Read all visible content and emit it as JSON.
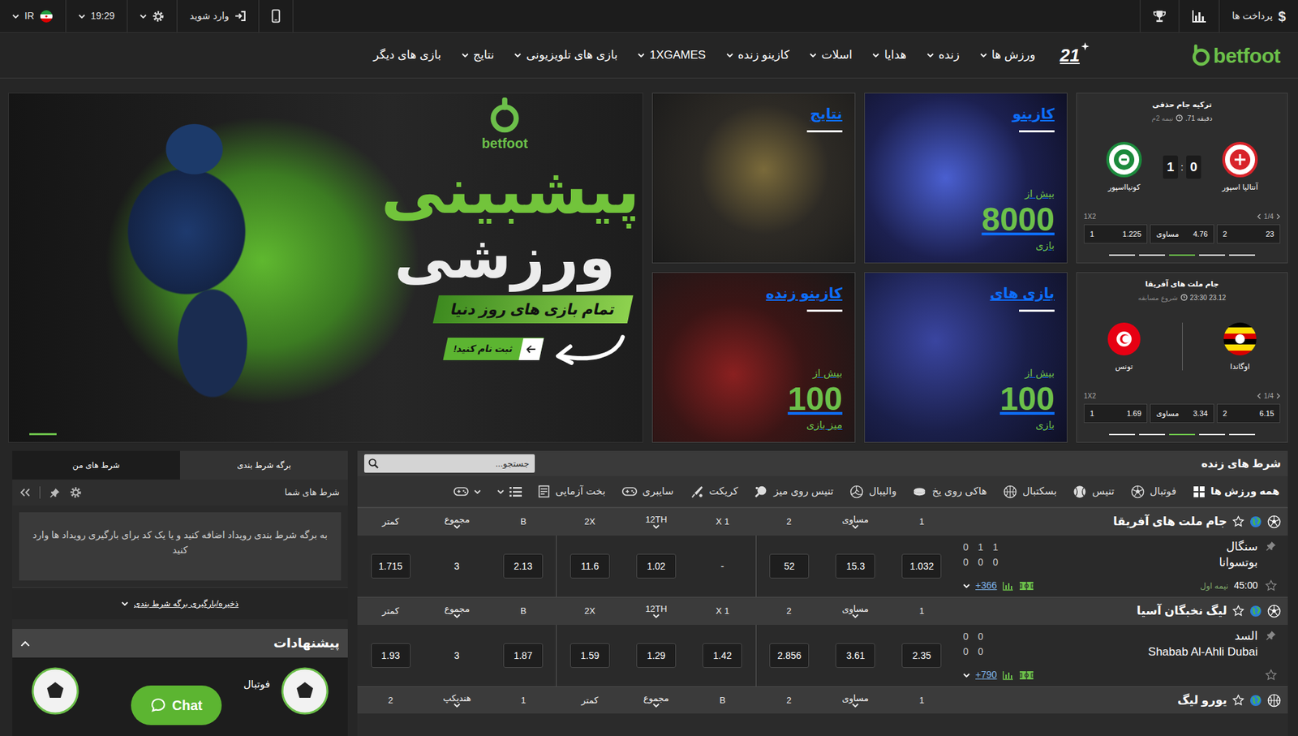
{
  "topbar": {
    "country": "IR",
    "time": "19:29",
    "login": "وارد شوید",
    "currency": "$",
    "payments": "پرداخت ها"
  },
  "nav": {
    "logo": "betfoot",
    "badge": "21",
    "items": [
      {
        "label": "ورزش ها",
        "dropdown": true
      },
      {
        "label": "زنده",
        "dropdown": true
      },
      {
        "label": "هدایا",
        "dropdown": true
      },
      {
        "label": "اسلات",
        "dropdown": true
      },
      {
        "label": "کازینو زنده",
        "dropdown": true
      },
      {
        "label": "1XGAMES",
        "dropdown": true
      },
      {
        "label": "بازی های تلویزیونی",
        "dropdown": true
      },
      {
        "label": "نتایج",
        "dropdown": true
      },
      {
        "label": "بازی های دیگر",
        "dropdown": false
      }
    ]
  },
  "banner": {
    "brand": "betfoot",
    "headline": "پیشبینی",
    "subheadline": "ورزشی",
    "tagline": "تمام بازی های روز دنیا",
    "cta": "ثبت نام کنید!",
    "slides": [
      {
        "selected": true
      }
    ]
  },
  "tile_columns": [
    [
      {
        "title": "کازینو",
        "prefix": "بیش از",
        "count": "8000",
        "unit": "بازی"
      },
      {
        "title": "بازی های",
        "prefix": "بیش از",
        "count": "100",
        "unit": "بازی"
      }
    ],
    [
      {
        "title": "نتایج"
      },
      {
        "title": "کازینو زنده",
        "prefix": "بیش از",
        "count": "100",
        "unit": "میز بازی"
      }
    ]
  ],
  "match_cards": [
    {
      "league": "ترکیه جام حذفی",
      "status": "دقیقه 71.",
      "phase": "نیمه 2م",
      "teams": [
        {
          "name": "آنتالیا اسپور",
          "score": "0"
        },
        {
          "name": "کونیااسپور",
          "score": "1"
        }
      ],
      "score_sep": ":",
      "market": "1X2",
      "page": "1/4",
      "odds": [
        {
          "label": "1",
          "value": "1.225"
        },
        {
          "label": "مساوی",
          "value": "4.76"
        },
        {
          "label": "2",
          "value": "23"
        }
      ],
      "dots": [
        {
          "selected": false
        },
        {
          "selected": false
        },
        {
          "selected": true
        },
        {
          "selected": false
        },
        {
          "selected": false
        }
      ]
    },
    {
      "league": "جام ملت های آفریقا",
      "status": "23.12 23:30",
      "phase": "شروع مسابقه",
      "teams": [
        {
          "name": "اوگاندا"
        },
        {
          "name": "تونس"
        }
      ],
      "market": "1X2",
      "page": "1/4",
      "odds": [
        {
          "label": "1",
          "value": "1.69"
        },
        {
          "label": "مساوی",
          "value": "3.34"
        },
        {
          "label": "2",
          "value": "6.15"
        }
      ],
      "dots": [
        {
          "selected": false
        },
        {
          "selected": false
        },
        {
          "selected": true
        },
        {
          "selected": false
        },
        {
          "selected": false
        }
      ]
    }
  ],
  "live": {
    "title": "شرط های زنده",
    "search_placeholder": "جستجو...",
    "sports": [
      {
        "label": "همه ورزش ها",
        "selected": true
      },
      {
        "label": "فوتبال",
        "selected": false
      },
      {
        "label": "تنیس",
        "selected": false
      },
      {
        "label": "بسکتبال",
        "selected": false
      },
      {
        "label": "هاکی روی یخ",
        "selected": false
      },
      {
        "label": "والیبال",
        "selected": false
      },
      {
        "label": "تنیس روی میز",
        "selected": false
      },
      {
        "label": "کریکت",
        "selected": false
      },
      {
        "label": "سایبری",
        "selected": false
      },
      {
        "label": "بخت آزمایی",
        "selected": false
      }
    ],
    "sections": [
      {
        "title": "جام ملت های آفریقا",
        "kind": "soccer",
        "headers": [
          {
            "label": "1",
            "dropdown": false
          },
          {
            "label": "مساوی",
            "dropdown": true
          },
          {
            "label": "2",
            "dropdown": false
          },
          {
            "label": "X 1",
            "dropdown": false
          },
          {
            "label": "12TH",
            "dropdown": true
          },
          {
            "label": "2X",
            "dropdown": false
          },
          {
            "label": "B",
            "dropdown": false
          },
          {
            "label": "مجموع",
            "dropdown": true
          },
          {
            "label": "کمتر",
            "dropdown": false
          }
        ],
        "matches": [
          {
            "teams": [
              "سنگال",
              "بوتسوانا"
            ],
            "scores": [
              [
                "0",
                "1",
                "1"
              ],
              [
                "0",
                "0",
                "0"
              ]
            ],
            "time": "45:00",
            "phase": "نیمه اول",
            "markets": "366+",
            "odds": [
              {
                "value": "1.032",
                "kind": "odd"
              },
              {
                "value": "15.3",
                "kind": "odd"
              },
              {
                "value": "52",
                "kind": "odd"
              },
              {
                "value": "-",
                "kind": "closed"
              },
              {
                "value": "1.02",
                "kind": "odd"
              },
              {
                "value": "11.6",
                "kind": "odd"
              },
              {
                "value": "2.13",
                "kind": "odd"
              },
              {
                "value": "3",
                "kind": "line"
              },
              {
                "value": "1.715",
                "kind": "odd"
              }
            ]
          }
        ]
      },
      {
        "title": "لیگ نخبگان آسیا",
        "kind": "soccer",
        "headers": [
          {
            "label": "1",
            "dropdown": false
          },
          {
            "label": "مساوی",
            "dropdown": true
          },
          {
            "label": "2",
            "dropdown": false
          },
          {
            "label": "X 1",
            "dropdown": false
          },
          {
            "label": "12TH",
            "dropdown": true
          },
          {
            "label": "2X",
            "dropdown": false
          },
          {
            "label": "B",
            "dropdown": false
          },
          {
            "label": "مجموع",
            "dropdown": true
          },
          {
            "label": "کمتر",
            "dropdown": false
          }
        ],
        "matches": [
          {
            "teams": [
              "السد",
              "Shabab Al-Ahli Dubai"
            ],
            "scores": [
              [
                "0",
                "0"
              ],
              [
                "0",
                "0"
              ]
            ],
            "markets": "790+",
            "odds": [
              {
                "value": "2.35",
                "kind": "odd"
              },
              {
                "value": "3.61",
                "kind": "odd"
              },
              {
                "value": "2.856",
                "kind": "odd"
              },
              {
                "value": "1.42",
                "kind": "odd"
              },
              {
                "value": "1.29",
                "kind": "odd"
              },
              {
                "value": "1.59",
                "kind": "odd"
              },
              {
                "value": "1.87",
                "kind": "odd"
              },
              {
                "value": "3",
                "kind": "line"
              },
              {
                "value": "1.93",
                "kind": "odd"
              }
            ]
          }
        ]
      },
      {
        "title": "یورو لیگ",
        "kind": "basketball",
        "headers": [
          {
            "label": "1",
            "dropdown": false
          },
          {
            "label": "مساوی",
            "dropdown": true
          },
          {
            "label": "2",
            "dropdown": false
          },
          {
            "label": "B",
            "dropdown": false
          },
          {
            "label": "مجموع",
            "dropdown": true
          },
          {
            "label": "کمتر",
            "dropdown": false
          },
          {
            "label": "1",
            "dropdown": false
          },
          {
            "label": "هندیکپ",
            "dropdown": true
          },
          {
            "label": "2",
            "dropdown": false
          }
        ],
        "matches": []
      }
    ]
  },
  "betslip": {
    "tabs": [
      {
        "label": "برگه شرط بندی",
        "selected": true
      },
      {
        "label": "شرط های من",
        "selected": false
      }
    ],
    "heading": "شرط های شما",
    "message": "به برگه شرط بندی رویداد اضافه کنید و یا یک کد برای بارگیری رویداد ها وارد کنید",
    "save": "ذخیره/بارگیری برگه شرط بندی"
  },
  "suggestions": {
    "title": "پیشنهادات",
    "items": [
      {
        "sport": "فوتبال"
      }
    ]
  },
  "chat": {
    "label": "Chat"
  }
}
